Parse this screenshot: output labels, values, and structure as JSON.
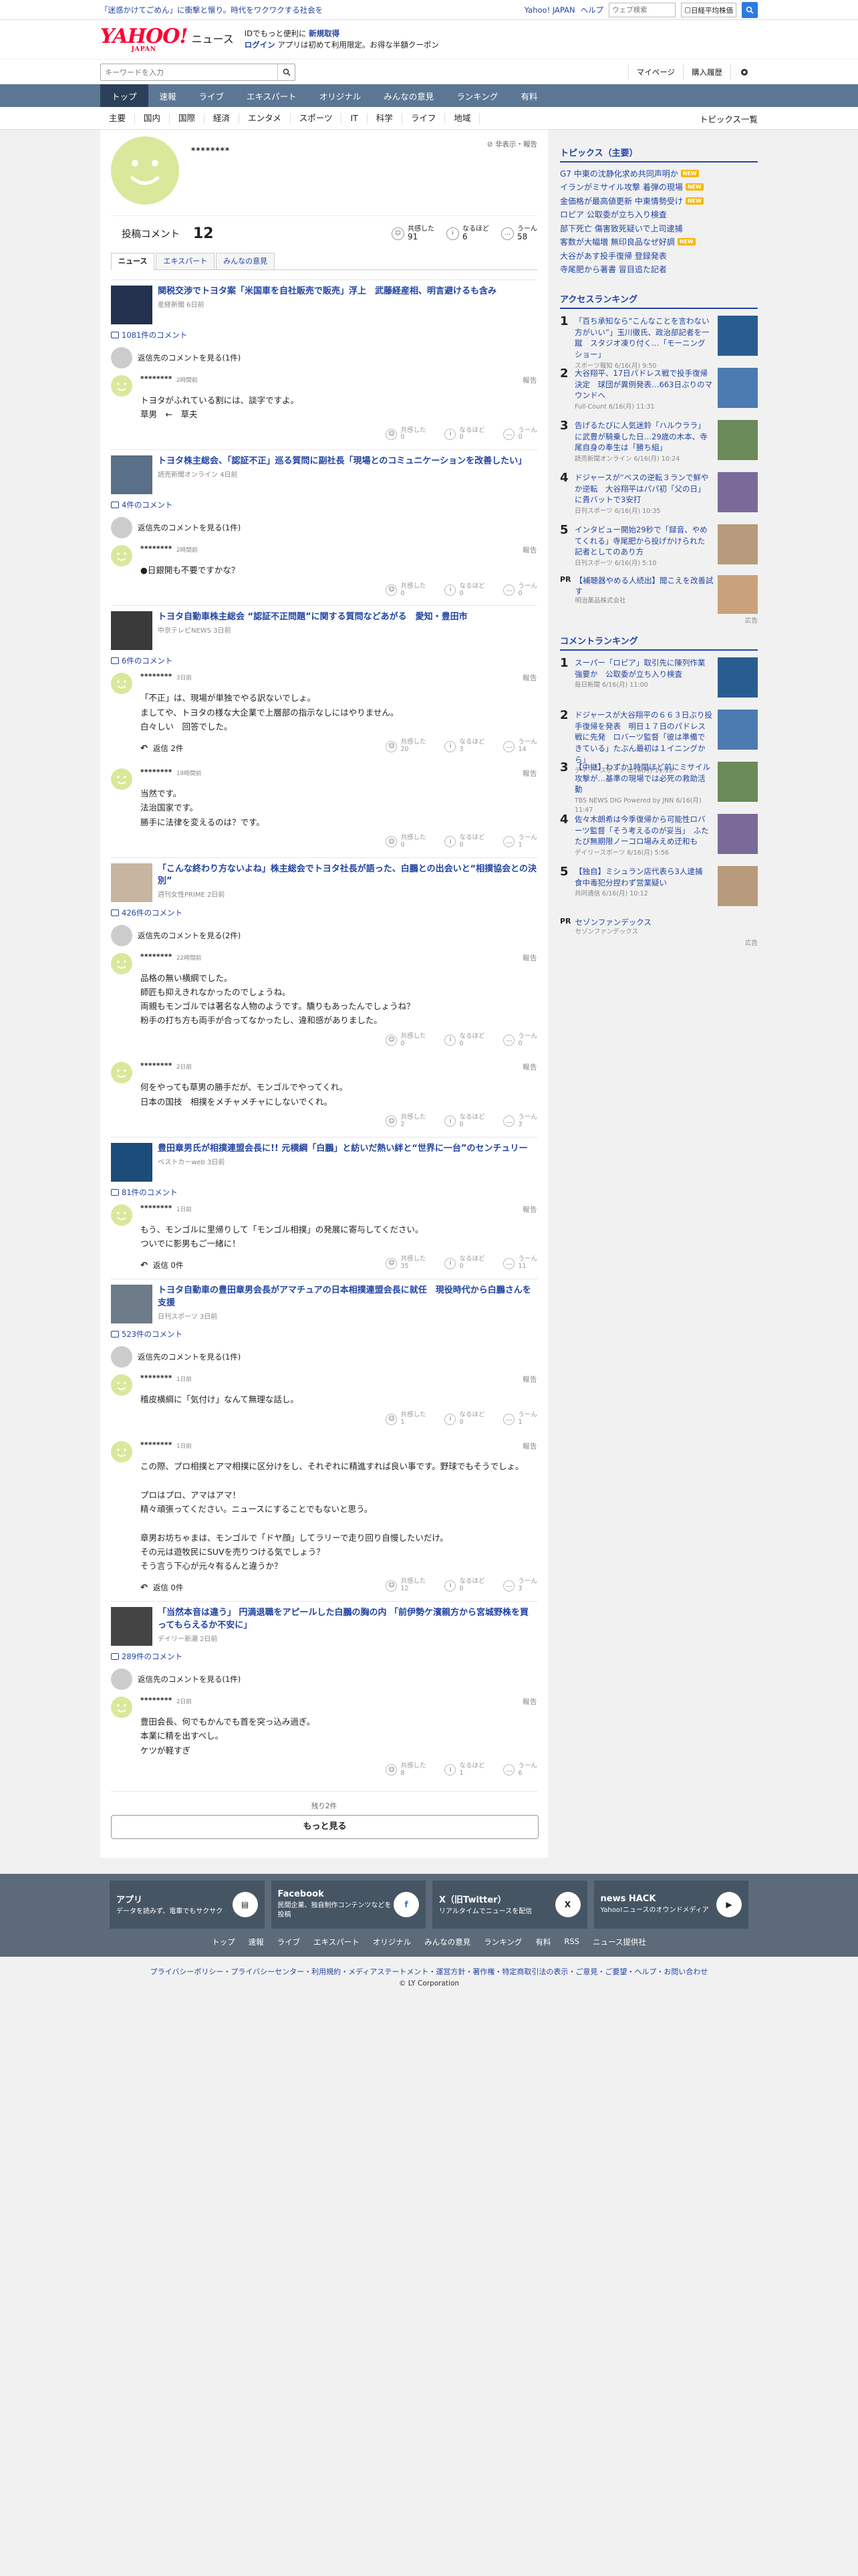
{
  "topbar": {
    "promo": "「迷惑かけてごめん」に衝撃と懐り。時代をワクワクする社会を",
    "link1": "Yahoo! JAPAN",
    "link2": "ヘルプ",
    "web_placeholder": "ウェブ検索",
    "stock": "日経平均株価"
  },
  "header": {
    "logo": "YAHOO!",
    "logo_sub": "JAPAN",
    "logo_news": "ニュース",
    "msg1a": "IDでもっと便利に",
    "msg1b": "新規取得",
    "msg2a": "ログイン",
    "msg2b": "アプリは初めて利用限定。お得な半額クーポン"
  },
  "search": {
    "placeholder": "キーワードを入力",
    "mypage": "マイページ",
    "history": "購入履歴"
  },
  "nav": [
    "トップ",
    "速報",
    "ライブ",
    "エキスパート",
    "オリジナル",
    "みんなの意見",
    "ランキング",
    "有料"
  ],
  "subnav": [
    "主要",
    "国内",
    "国際",
    "経済",
    "エンタメ",
    "スポーツ",
    "IT",
    "科学",
    "ライフ",
    "地域"
  ],
  "subnav_right": "トピックス一覧",
  "profile": {
    "name": "********",
    "hide": "非表示・報告",
    "comment_label": "投稿コメント",
    "comment_count": "12",
    "reactions": [
      {
        "label": "共感した",
        "count": "91",
        "icon": "☺"
      },
      {
        "label": "なるほど",
        "count": "6",
        "icon": "i"
      },
      {
        "label": "うーん",
        "count": "58",
        "icon": "…"
      }
    ]
  },
  "tabs": [
    "ニュース",
    "エキスパート",
    "みんなの意見"
  ],
  "articles": [
    {
      "title": "関税交渉でトヨタ案「米国車を自社販売で販売」浮上　武藤経産相、明言避けるも含み",
      "source": "産経新聞 6日前",
      "count": "1081件のコメント",
      "prev": "返信先のコメントを見る(1件)",
      "comments": [
        {
          "name": "********",
          "time": "2時間前",
          "text": "トヨタがふれている割には、談字ですよ。\n草男　←　草夫",
          "reply": "",
          "r": [
            "0",
            "0",
            "0"
          ]
        }
      ]
    },
    {
      "title": "トヨタ株主総会、「認証不正」巡る質問に副社長「現場とのコミュニケーションを改善したい」",
      "source": "読売新聞オンライン 4日前",
      "count": "4件のコメント",
      "prev": "返信先のコメントを見る(1件)",
      "comments": [
        {
          "name": "********",
          "time": "2時間前",
          "text": "●日銀開も不要ですかな？",
          "reply": "",
          "r": [
            "0",
            "0",
            "0"
          ]
        }
      ]
    },
    {
      "title": "トヨタ自動車株主総会 “認証不正問題”に関する質問などあがる　愛知・豊田市",
      "source": "中京テレビNEWS 3日前",
      "count": "6件のコメント",
      "prev": "",
      "comments": [
        {
          "name": "********",
          "time": "3日前",
          "text": "「不正」は、現場が単独でやる訳ないでしょ。\nましてや、トヨタの様な大企業で上層部の指示なしにはやりません。\n白々しい　回答でした。",
          "reply": "返信 2件",
          "r": [
            "20",
            "3",
            "14"
          ]
        },
        {
          "name": "********",
          "time": "18時間前",
          "text": "当然です。\n法治国家です。\n勝手に法律を変えるのは？です。",
          "reply": "",
          "r": [
            "0",
            "0",
            "1"
          ]
        }
      ]
    },
    {
      "title": "「こんな終わり方ないよね」株主総会でトヨタ社長が語った、白鵬との出会いと“相撲協会との決別”",
      "source": "週刊女性PRIME 2日前",
      "count": "426件のコメント",
      "prev": "返信先のコメントを見る(2件)",
      "comments": [
        {
          "name": "********",
          "time": "22時間前",
          "text": "品格の無い横綱でした。\n師匠も抑えきれなかったのでしょうね。\n両親もモンゴルでは著名な人物のようです。驕りもあったんでしょうね？\n粉手の打ち方も両手が合ってなかったし、違和感がありました。",
          "reply": "",
          "r": [
            "0",
            "0",
            "0"
          ]
        },
        {
          "name": "********",
          "time": "2日前",
          "text": "何をやっても草男の勝手だが、モンゴルでやってくれ。\n日本の国技　相撲をメチャメチャにしないでくれ。",
          "reply": "",
          "r": [
            "2",
            "0",
            "3"
          ]
        }
      ]
    },
    {
      "title": "豊田章男氏が相撲連盟会長に!! 元横綱「白鵬」と紡いだ熱い絆と“世界に一台”のセンチュリー",
      "source": "ベストカーweb 3日前",
      "count": "81件のコメント",
      "prev": "",
      "comments": [
        {
          "name": "********",
          "time": "1日前",
          "text": "もう、モンゴルに里帰りして「モンゴル相撲」の発展に寄与してください。\nついでに影男もご一緒に！",
          "reply": "返信 0件",
          "r": [
            "35",
            "0",
            "11"
          ]
        }
      ]
    },
    {
      "title": "トヨタ自動車の豊田章男会長がアマチュアの日本相撲連盟会長に就任　現役時代から白鵬さんを支援",
      "source": "日刊スポーツ 3日前",
      "count": "523件のコメント",
      "prev": "返信先のコメントを見る(1件)",
      "comments": [
        {
          "name": "********",
          "time": "1日前",
          "text": "稽皮横綱に「気付け」なんて無理な話し。",
          "reply": "",
          "r": [
            "1",
            "0",
            "1"
          ]
        },
        {
          "name": "********",
          "time": "1日前",
          "text": "この際、プロ相撲とアマ相撲に区分けをし、それぞれに精進すれば良い事です。野球でもそうでしょ。\n\nプロはプロ、アマはアマ！\n精々頑張ってください。ニュースにすることでもないと思う。\n\n章男お坊ちゃまは、モンゴルで「ドヤ顔」してラリーで走り回り自慢したいだけ。\nその元は遊牧民にSUVを売りつける気でしょう？\nそう言う下心が元々有るんと違うか？",
          "reply": "返信 0件",
          "r": [
            "12",
            "0",
            "3"
          ]
        }
      ]
    },
    {
      "title": "「当然本音は違う」 円満退職をアピールした白鵬の胸の内 「前伊勢ケ濱親方から宮城野株を買ってもらえるか不安に」",
      "source": "デイリー新潮 2日前",
      "count": "289件のコメント",
      "prev": "返信先のコメントを見る(1件)",
      "comments": [
        {
          "name": "********",
          "time": "2日前",
          "text": "豊田会長、何でもかんでも首を突っ込み過ぎ。\n本業に精を出すべし。\nケツが軽すぎ",
          "reply": "",
          "r": [
            "8",
            "1",
            "6"
          ]
        }
      ]
    }
  ],
  "more": {
    "remain": "残り2件",
    "button": "もっと見る"
  },
  "side": {
    "topics_title": "トピックス（主要）",
    "topics": [
      {
        "t": "G7 中東の沈静化求め共同声明か",
        "b": "NEW"
      },
      {
        "t": "イランがミサイル攻撃 着弾の現場",
        "b": "NEW"
      },
      {
        "t": "金価格が最高値更新 中東情勢受け",
        "b": "NEW"
      },
      {
        "t": "ロピア 公取委が立ち入り検査",
        "b": ""
      },
      {
        "t": "部下死亡 傷害致死疑いで上司逮捕",
        "b": ""
      },
      {
        "t": "客数が大幅増 無印良品なぜ好調",
        "b": "NEW"
      },
      {
        "t": "大谷があす投手復帰 登録発表",
        "b": ""
      },
      {
        "t": "寺尾肥から著書 冒目追た記者",
        "b": ""
      }
    ],
    "access_title": "アクセスランキング",
    "access": [
      {
        "t": "「百ち承知なら“こんなことを言わない方がいい”」玉川徹氏、政治部記者を一蹴　スタジオ凍り付く…「モーニングショー」",
        "s": "スポーツ報知 6/16(月) 9:50"
      },
      {
        "t": "大谷翔平、17日パドレス戦で投手復帰決定　球団が異例発表…663日ぶりのマウンドへ",
        "s": "Full-Count 6/16(月) 11:31"
      },
      {
        "t": "告げるたびに人気迷鈴「ハルウララ」に武豊が騎乗した日…29歳の木本、寺尾自身の奉生は「勝ち組」",
        "s": "読売新聞オンライン 6/16(月) 10:24"
      },
      {
        "t": "ドジャースが“ベスの逆転３ランで鮮やか逆転　大谷翔平はパパ初「父の日」に貴バットで3安打",
        "s": "日刊スポーツ 6/16(月) 10:35"
      },
      {
        "t": "インタビュー開始29秒で「録音、やめてくれる」寺尾肥から投げかけられた記者としてのあり方",
        "s": "日刊スポーツ 6/16(月) 5:10"
      }
    ],
    "pr1": {
      "t": "【補聴器やめる人続出】聞こえを改善試す",
      "s": "明治薬品株式会社",
      "label": "広告"
    },
    "comment_title": "コメントランキング",
    "comment_rank": [
      {
        "t": "スーパー「ロピア」取引先に陳列作業強要か　公取委が立ち入り検査",
        "s": "毎日新聞 6/16(月) 11:00"
      },
      {
        "t": "ドジャースが大谷翔平の６６３日ぶり投手復帰を発表　明日１７日のパドレス戦に先発　ロバーツ監督「彼は準備できている」たぶん最初は１イニングから」",
        "s": "デイリースポーツ 6/16(月) 11:13"
      },
      {
        "t": "【中継】わずか1時間ほど前にミサイル攻撃が…基準の現場では必死の救助活動",
        "s": "TBS NEWS DIG Powered by JNN 6/16(月) 11:47"
      },
      {
        "t": "佐々木朗希は今季復帰から可能性ロバーツ監督「そう考えるのが妥当」　ふたたび無期限ノーコロ場みえめ迂和も",
        "s": "デイリースポーツ 6/16(月) 5:56"
      },
      {
        "t": "【独自】ミシュラン店代表ら3人逮捕　食中毒犯分捏わず営業疑い",
        "s": "共同通信 6/16(月) 10:12"
      }
    ],
    "pr2": {
      "t": "セゾンファンデックス",
      "s": "セゾンファンデックス",
      "label": "広告"
    }
  },
  "footer": {
    "boxes": [
      {
        "t": "アプリ",
        "d": "データを読みず、電車でもサクサク"
      },
      {
        "t": "Facebook",
        "d": "民間企業、独自制作コンテンツなどを投稿"
      },
      {
        "t": "X（旧Twitter）",
        "d": "リアルタイムでニュースを配信"
      },
      {
        "t": "news HACK",
        "d": "Yahoo!ニュースのオウンドメディア"
      }
    ],
    "links": [
      "トップ",
      "速報",
      "ライブ",
      "エキスパート",
      "オリジナル",
      "みんなの意見",
      "ランキング",
      "有料",
      "RSS",
      "ニュース提供社"
    ],
    "bottom": "プライバシーポリシー・プライバシーセンター・利用規約・メディアステートメント・運営方針・著作権・特定商取引法の表示・ご意見・ご要望・ヘルプ・お問い合わせ",
    "copyright": "© LY Corporation"
  }
}
